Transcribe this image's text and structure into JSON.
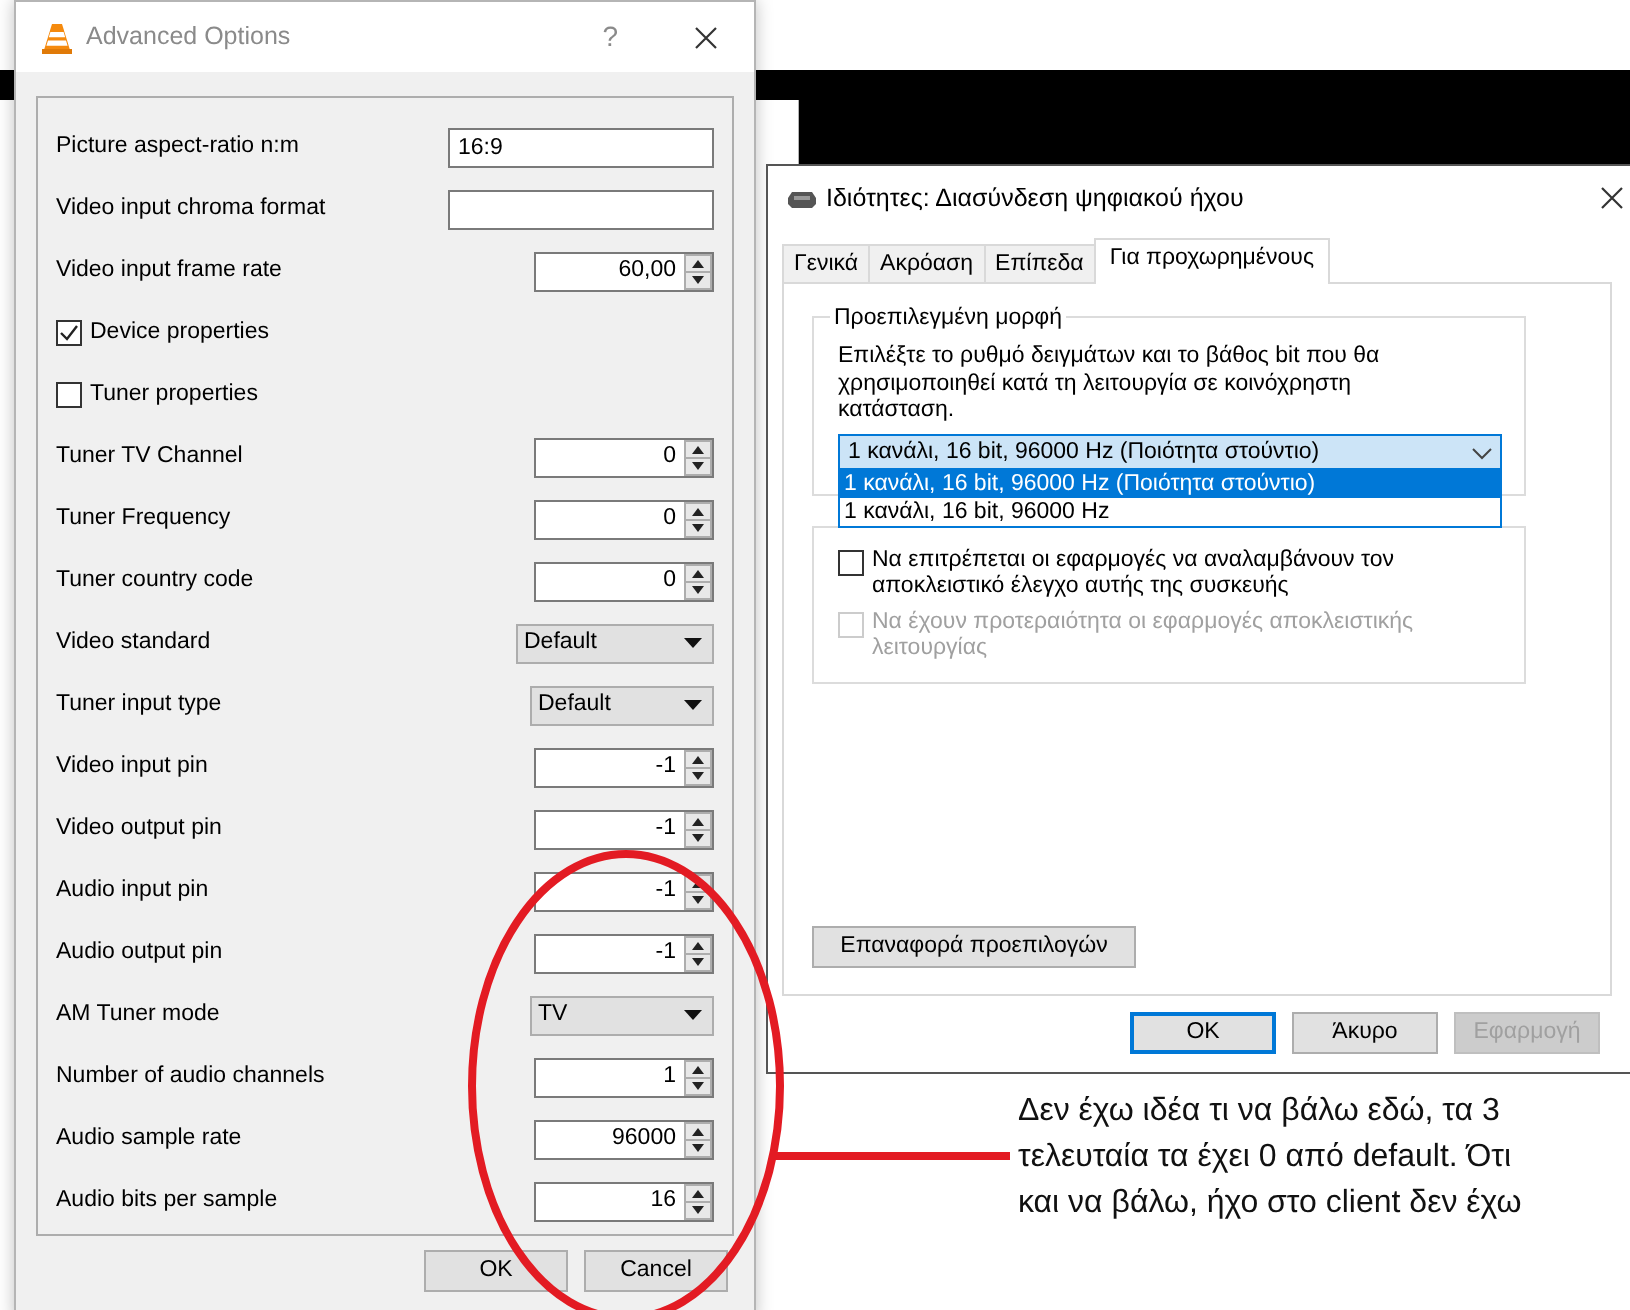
{
  "advanced_options": {
    "title": "Advanced Options",
    "help": "?",
    "options": [
      {
        "kind": "text",
        "label": "Picture aspect-ratio n:m",
        "value": "16:9"
      },
      {
        "kind": "text",
        "label": "Video input chroma format"
      },
      {
        "kind": "spin",
        "label": "Video input frame rate",
        "value": "60,00"
      },
      {
        "kind": "check",
        "label": "Device properties",
        "checked": true
      },
      {
        "kind": "check",
        "label": "Tuner properties",
        "checked": false
      },
      {
        "kind": "spin",
        "label": "Tuner TV Channel",
        "value": "0"
      },
      {
        "kind": "spin",
        "label": "Tuner Frequency",
        "value": "0"
      },
      {
        "kind": "spin",
        "label": "Tuner country code",
        "value": "0"
      },
      {
        "kind": "combo",
        "label": "Video standard",
        "value": "Default"
      },
      {
        "kind": "combo",
        "label": "Tuner input type",
        "value": "Default"
      },
      {
        "kind": "spin",
        "label": "Video input pin",
        "value": "-1"
      },
      {
        "kind": "spin",
        "label": "Video output pin",
        "value": "-1"
      },
      {
        "kind": "spin",
        "label": "Audio input pin",
        "value": "-1"
      },
      {
        "kind": "spin",
        "label": "Audio output pin",
        "value": "-1"
      },
      {
        "kind": "combo",
        "label": "AM Tuner mode",
        "value": "TV"
      },
      {
        "kind": "spin",
        "label": "Number of audio channels",
        "value": "1"
      },
      {
        "kind": "spin",
        "label": "Audio sample rate",
        "value": "96000"
      },
      {
        "kind": "spin",
        "label": "Audio bits per sample",
        "value": "16"
      }
    ],
    "buttons": [
      "OK",
      "Cancel"
    ]
  },
  "properties": {
    "title": "Ιδιότητες: Διασύνδεση ψηφιακού ήχου",
    "tabs": [
      {
        "label": "Γενικά",
        "selected": false
      },
      {
        "label": "Ακρόαση",
        "selected": false
      },
      {
        "label": "Επίπεδα",
        "selected": false
      },
      {
        "label": "Για προχωρημένους",
        "selected": true
      }
    ],
    "default_format": {
      "legend": "Προεπιλεγμένη μορφή",
      "description": "Επιλέξτε το ρυθμό δειγμάτων και το βάθος bit που θα χρησιμοποιηθεί κατά τη λειτουργία σε κοινόχρηστη κατάσταση.",
      "dropdown": {
        "value": "1 κανάλι, 16 bit, 96000 Hz (Ποιότητα στούντιο)",
        "options": [
          {
            "label": "1 κανάλι, 16 bit, 96000 Hz (Ποιότητα στούντιο)",
            "selected": true
          },
          {
            "label": "1 κανάλι, 16 bit, 96000 Hz",
            "selected": false
          }
        ]
      }
    },
    "exclusive_mode": {
      "options": [
        {
          "label": "Να επιτρέπεται οι εφαρμογές να αναλαμβάνουν τον αποκλειστικό έλεγχο αυτής της συσκευής",
          "checked": false,
          "disabled": false
        },
        {
          "label": "Να έχουν προτεραιότητα οι εφαρμογές αποκλειστικής λειτουργίας",
          "checked": false,
          "disabled": true
        }
      ]
    },
    "restore_button": "Επαναφορά προεπιλογών",
    "buttons": [
      {
        "label": "OK",
        "default": true,
        "disabled": false
      },
      {
        "label": "Άκυρο",
        "default": false,
        "disabled": false
      },
      {
        "label": "Εφαρμογή",
        "default": false,
        "disabled": true
      }
    ]
  },
  "annotation": {
    "text": "Δεν έχω ιδέα τι να βάλω εδώ, τα 3 τελευταία τα έχει 0 από default. Ότι και να βάλω, ήχο στο client δεν έχω"
  }
}
